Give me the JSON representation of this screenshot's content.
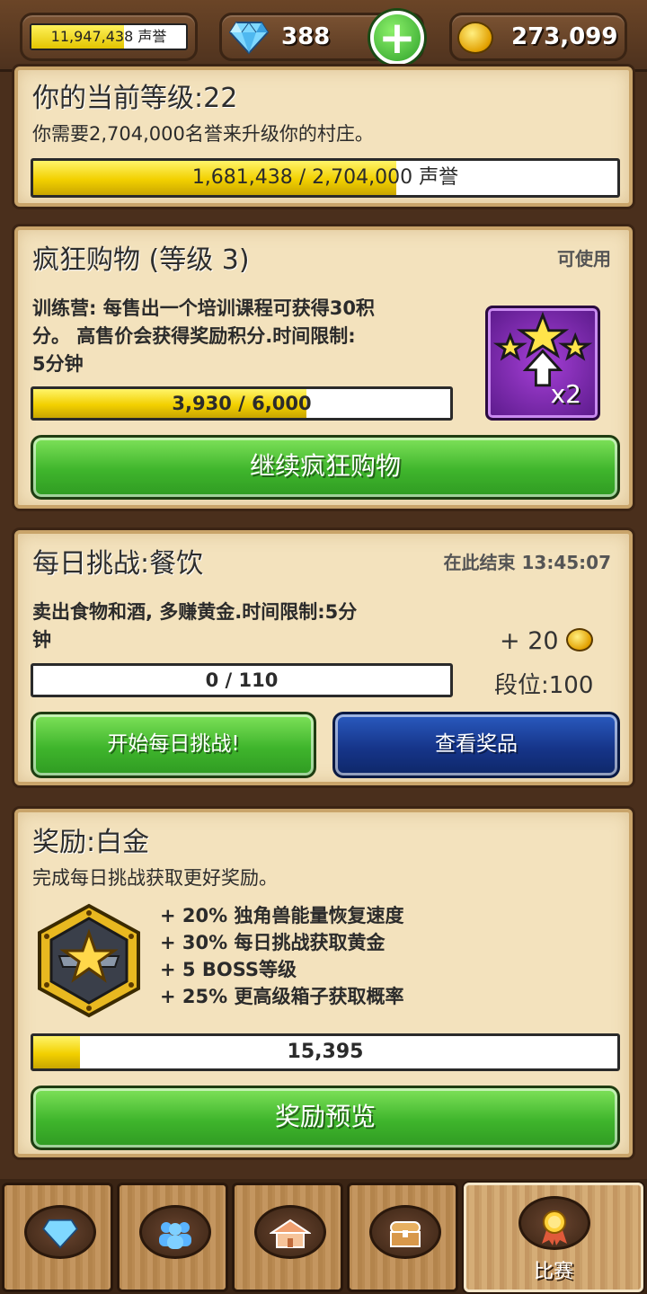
{
  "topbar": {
    "reputation_value": "11,947,438",
    "reputation_unit": "声誉",
    "reputation_fill": 0.6,
    "gems": "388",
    "coins": "273,099",
    "add_label": "+"
  },
  "level_panel": {
    "title": "你的当前等级:22",
    "text": "你需要2,704,000名誉来升级你的村庄。",
    "progress_text": "1,681,438 / 2,704,000",
    "progress_unit": "声誉",
    "progress_fraction": 0.622
  },
  "frenzy_panel": {
    "title": "疯狂购物 (等级 3)",
    "status": "可使用",
    "text_line1": "训练营: 每售出一个培训课程可获得30积",
    "text_line2": "分。 高售价会获得奖励积分.时间限制:",
    "text_line3": "5分钟",
    "multiplier": "x2",
    "progress_text": "3,930 / 6,000",
    "progress_fraction": 0.655,
    "button_label": "继续疯狂购物"
  },
  "daily_panel": {
    "title": "每日挑战:餐饮",
    "ends_label": "在此结束 13:45:07",
    "text_line1": "卖出食物和酒, 多赚黄金.时间限制:5分",
    "text_line2": "钟",
    "reward": "+ 20",
    "rank": "段位:100",
    "progress_text": "0 / 110",
    "progress_fraction": 0,
    "start_button": "开始每日挑战!",
    "view_button": "查看奖品"
  },
  "reward_panel": {
    "title": "奖励:白金",
    "text": "完成每日挑战获取更好奖励。",
    "bonuses": [
      "+ 20% 独角兽能量恢复速度",
      "+ 30% 每日挑战获取黄金",
      "+ 5 BOSS等级",
      "+ 25% 更高级箱子获取概率"
    ],
    "progress_text": "15,395",
    "progress_fraction": 0.08,
    "button_label": "奖励预览"
  },
  "nav": {
    "tabs": [
      {
        "icon": "gem-icon"
      },
      {
        "icon": "people-icon"
      },
      {
        "icon": "village-icon"
      },
      {
        "icon": "chest-icon"
      },
      {
        "icon": "medal-icon",
        "label": "比赛"
      }
    ]
  },
  "colors": {
    "panel_bg": "#f3e2bd",
    "progress_yellow": "#f2d000",
    "button_green": "#3fb52c",
    "button_blue": "#16358a",
    "frame_brown": "#4a2f1c"
  }
}
